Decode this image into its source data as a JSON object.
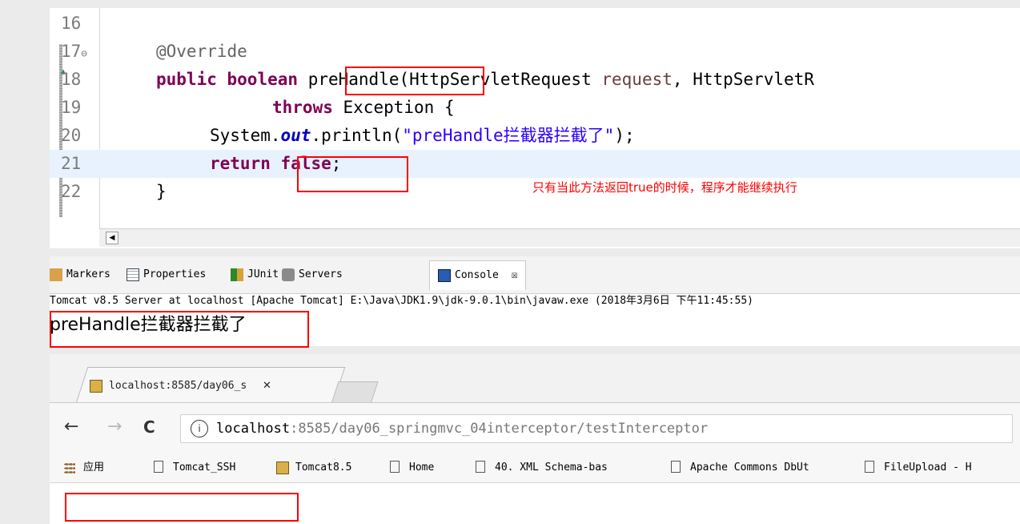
{
  "editor": {
    "lines": [
      {
        "num": "16",
        "code": ""
      },
      {
        "num": "17",
        "code": "@Override"
      },
      {
        "num": "18",
        "code": "public boolean preHandle(HttpServletRequest request, HttpServletR"
      },
      {
        "num": "19",
        "code": "throws Exception {"
      },
      {
        "num": "20",
        "code": "System.out.println(\"preHandle拦截器拦截了\");"
      },
      {
        "num": "21",
        "code": "return false;"
      },
      {
        "num": "22",
        "code": "}"
      }
    ],
    "tokens": {
      "override": "@Override",
      "public_kw": "public",
      "boolean_kw": "boolean",
      "method": "preHandle",
      "paren": "(",
      "type1": "HttpServletRequest",
      "param1": "request",
      "comma": ",",
      "type2": "HttpServletR",
      "throws_kw": "throws",
      "exception": "Exception {",
      "system": "System.",
      "out": "out",
      "println": ".println(",
      "string": "\"preHandle拦截器拦截了\"",
      "close_stmt": ");",
      "return_kw": "return",
      "false_kw": "false",
      "semicolon": ";",
      "close_brace": "}"
    },
    "annotation_note": "只有当此方法返回true的时候，程序才能继续执行"
  },
  "console": {
    "tabs": [
      {
        "label": "Markers",
        "icon": "markers-icon"
      },
      {
        "label": "Properties",
        "icon": "properties-icon"
      },
      {
        "label": "JUnit",
        "icon": "junit-icon"
      },
      {
        "label": "Servers",
        "icon": "servers-icon"
      },
      {
        "label": "Console",
        "icon": "console-icon",
        "active": true
      }
    ],
    "close_glyph": "☒",
    "description": "Tomcat v8.5 Server at localhost [Apache Tomcat] E:\\Java\\JDK1.9\\jdk-9.0.1\\bin\\javaw.exe (2018年3月6日 下午11:45:55)",
    "output": "preHandle拦截器拦截了"
  },
  "browser": {
    "tab_title": "localhost:8585/day06_s",
    "tab_close": "✕",
    "back": "←",
    "forward": "→",
    "reload": "C",
    "info": "i",
    "url_host": "localhost",
    "url_rest": ":8585/day06_springmvc_04interceptor/testInterceptor",
    "bookmarks": [
      {
        "label": "应用",
        "icon": "apps-icon"
      },
      {
        "label": "Tomcat_SSH",
        "icon": "page-icon"
      },
      {
        "label": "Tomcat8.5",
        "icon": "tomcat-icon"
      },
      {
        "label": "Home",
        "icon": "page-icon"
      },
      {
        "label": "40.  XML Schema-bas",
        "icon": "page-icon"
      },
      {
        "label": "Apache Commons DbUt",
        "icon": "page-icon"
      },
      {
        "label": "FileUpload - H",
        "icon": "page-icon"
      }
    ]
  },
  "colors": {
    "highlight_box": "#ff0000",
    "keyword": "#7f0055",
    "string": "#2a00ff",
    "field": "#0000c0",
    "current_line": "#e8f2fe"
  }
}
